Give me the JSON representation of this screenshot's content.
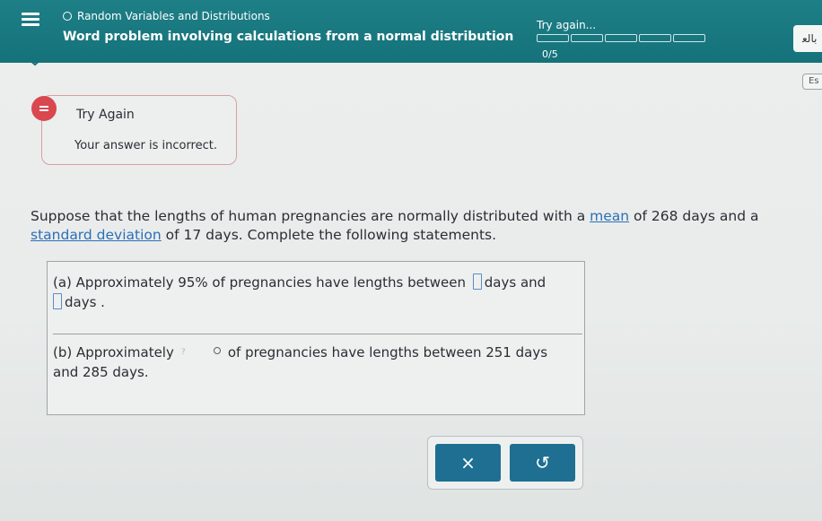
{
  "header": {
    "topic": "Random Variables and Distributions",
    "title": "Word problem involving calculations from a normal distribution",
    "progress_label": "Try again...",
    "progress_count": "0/5",
    "progress_value": 0,
    "progress_segments": 5,
    "language_button": "ﺑﺎﻟﻌ",
    "es_button": "Es"
  },
  "feedback": {
    "title": "Try Again",
    "message": "Your answer is incorrect."
  },
  "problem": {
    "text_1": "Suppose that the lengths of human pregnancies are normally distributed with a ",
    "mean_link": "mean",
    "text_2": " of 268 days and a ",
    "sd_link": "standard deviation",
    "text_3": " of 17 days. Complete the following statements."
  },
  "part_a": {
    "prefix": "(a) Approximately 95% of pregnancies have lengths between ",
    "middle": "days  and",
    "suffix": "days ."
  },
  "part_b": {
    "prefix": "(b) Approximately",
    "select_placeholder": "?",
    "suffix": "of pregnancies have lengths between 251 days",
    "suffix_2": "and 285 days."
  },
  "actions": {
    "clear_label": "×",
    "undo_label": "↺"
  },
  "colors": {
    "header": "#1e7f86",
    "button": "#1e6f92",
    "error": "#d9474f",
    "link": "#2a6fb8"
  }
}
